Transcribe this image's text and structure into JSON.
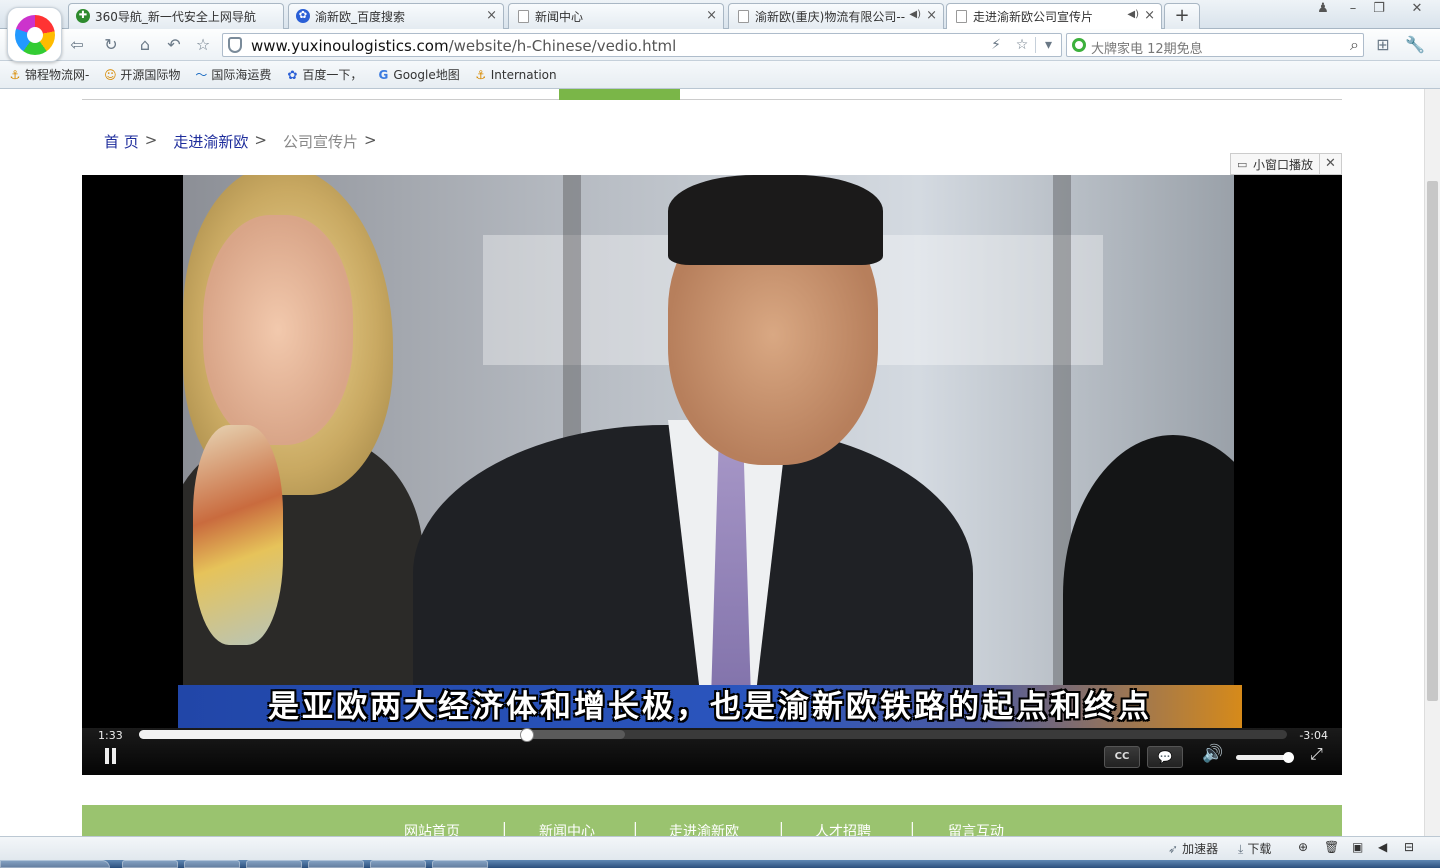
{
  "browser": {
    "tabs": [
      {
        "title": "360导航_新一代安全上网导航",
        "icon": "360-safe-icon",
        "color": "#2e8b2e"
      },
      {
        "title": "渝新欧_百度搜索",
        "icon": "baidu-paw-icon",
        "color": "#2a5fd6"
      },
      {
        "title": "新闻中心",
        "icon": "page-icon",
        "color": "#888888"
      },
      {
        "title": "渝新欧(重庆)物流有限公司--",
        "icon": "page-icon",
        "color": "#888888"
      },
      {
        "title": "走进渝新欧公司宣传片",
        "icon": "page-icon",
        "color": "#888888"
      }
    ],
    "new_tab_label": "+",
    "url_host": "www.yuxinoulogistics.com",
    "url_path": "/website/h-Chinese/vedio.html",
    "search_text": "大牌家电 12期免息",
    "bookmarks": [
      {
        "label": "锦程物流网-",
        "icon": "anchor-icon"
      },
      {
        "label": "开源国际物",
        "icon": "mascot-icon"
      },
      {
        "label": "国际海运费",
        "icon": "wave-icon"
      },
      {
        "label": "百度一下，",
        "icon": "baidu-paw-icon"
      },
      {
        "label": "Google地图",
        "icon": "google-g-icon"
      },
      {
        "label": "Internation",
        "icon": "anchor-icon"
      }
    ]
  },
  "page": {
    "breadcrumb": {
      "home": "首 页",
      "section": "走进渝新欧",
      "current": "公司宣传片",
      "separator": ">"
    },
    "mini_window_label": "小窗口播放",
    "mini_window_close": "✕",
    "footer_links": [
      "网站首页",
      "新闻中心",
      "走进渝新欧",
      "人才招聘",
      "留言互动"
    ],
    "footer_separator": "|"
  },
  "player": {
    "subtitle": "是亚欧两大经济体和增长极，也是渝新欧铁路的起点和终点",
    "time_elapsed": "1:33",
    "time_remaining": "-3:04",
    "progress": 0.338,
    "buffered": 0.423,
    "volume": 0.95,
    "cc_label": "CC",
    "comment_label": "💬"
  },
  "statusbar": {
    "accelerator": "加速器",
    "download": "下载"
  },
  "colors": {
    "accent_green": "#9ac36f",
    "link_blue": "#1e2d9c"
  }
}
